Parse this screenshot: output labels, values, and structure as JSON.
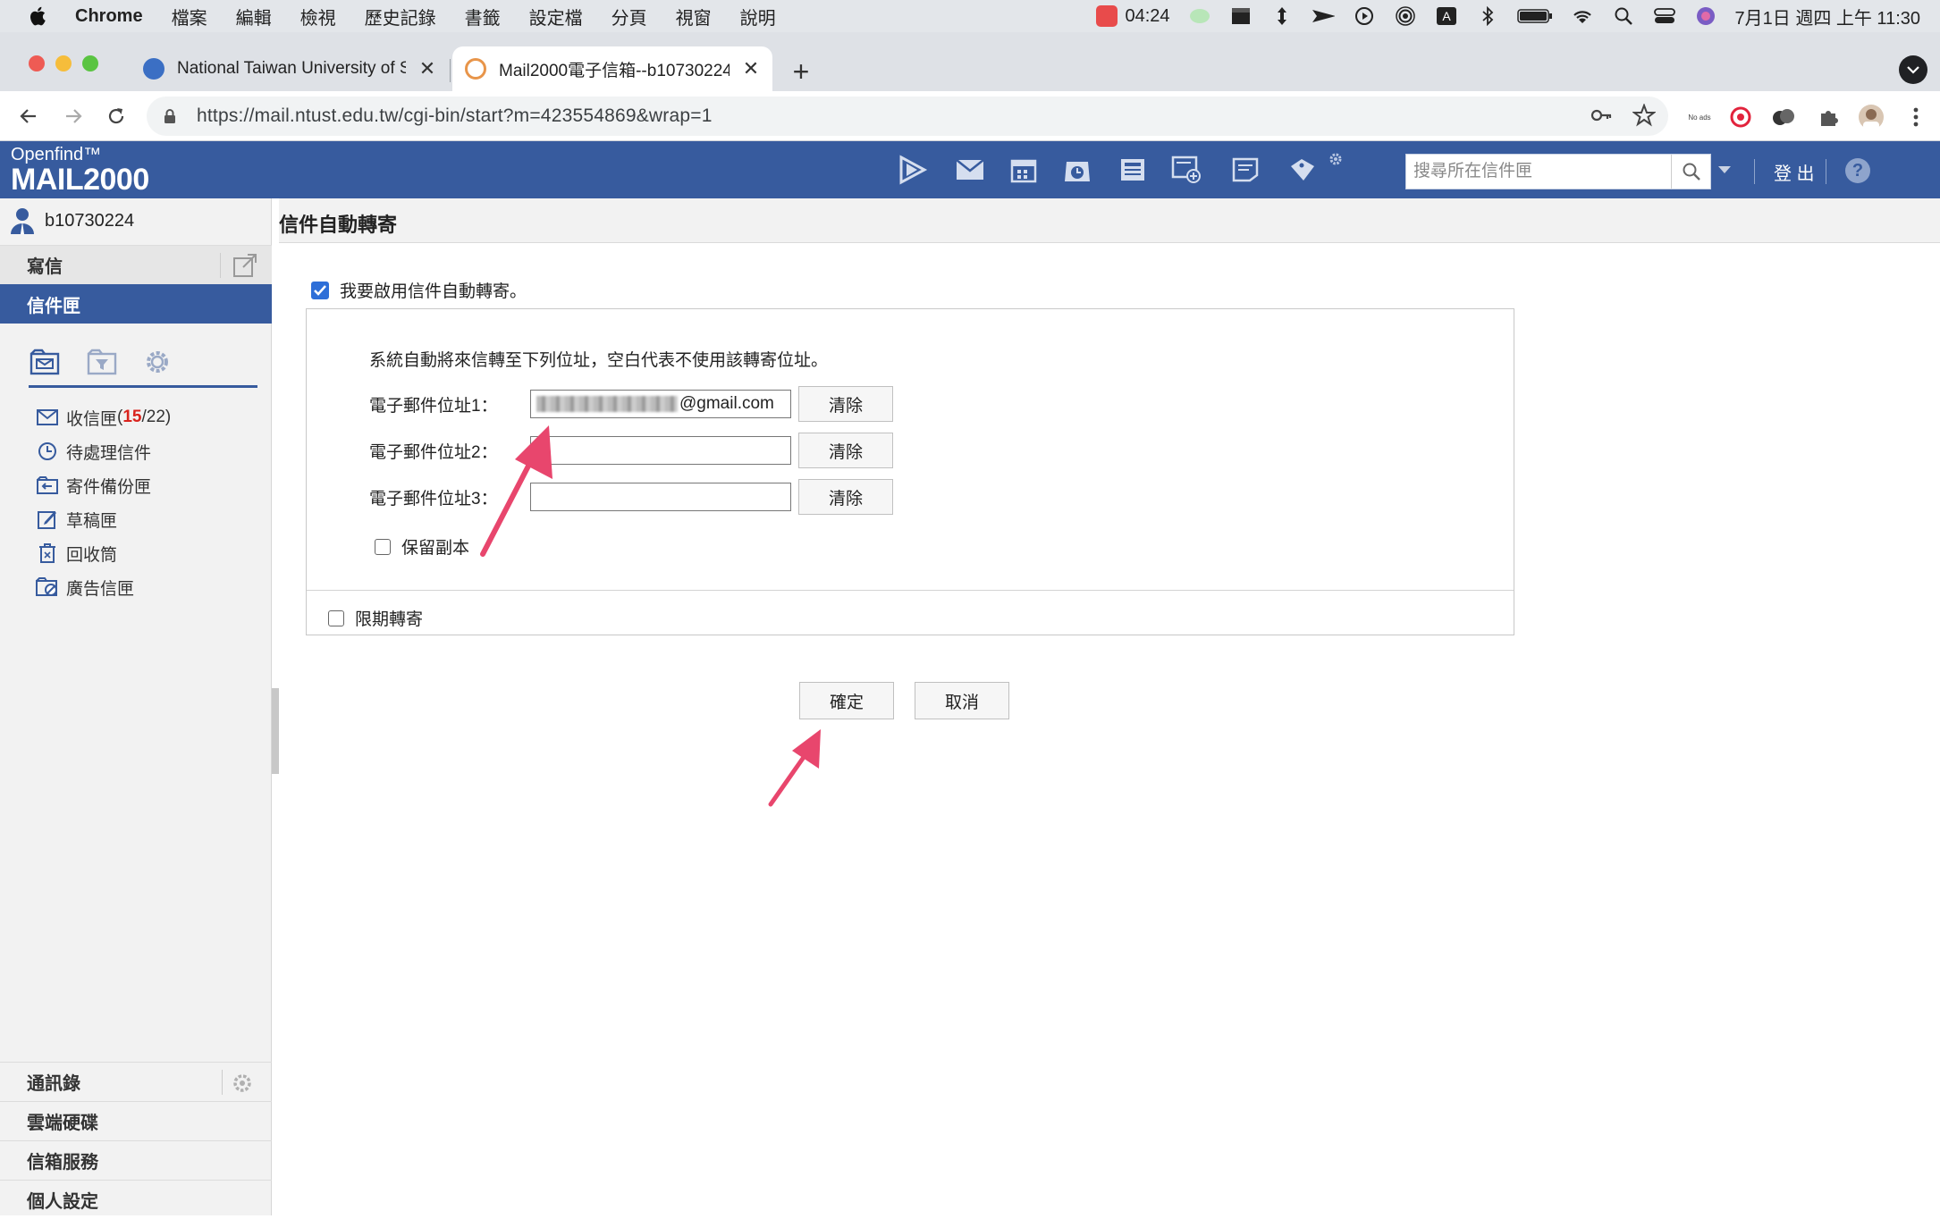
{
  "menubar": {
    "app_name": "Chrome",
    "items": [
      "檔案",
      "編輯",
      "檢視",
      "歷史記錄",
      "書籤",
      "設定檔",
      "分頁",
      "視窗",
      "說明"
    ],
    "timer": "04:24",
    "clock": "7月1日 週四 上午 11:30",
    "input_method": "A"
  },
  "browser": {
    "tabs": [
      {
        "title": "National Taiwan University of S",
        "active": false,
        "favicon_color": "#3b6fc4"
      },
      {
        "title": "Mail2000電子信箱--b10730224",
        "active": true,
        "favicon_color": "#e8954a"
      }
    ],
    "url": "https://mail.ntust.edu.tw/cgi-bin/start?m=423554869&wrap=1",
    "noads_label": "No ads"
  },
  "mail_header": {
    "logo_small": "Openfind™",
    "logo_big": "MAIL2000",
    "search_placeholder": "搜尋所在信件匣",
    "logout_label": "登 出",
    "help_label": "?"
  },
  "sidebar": {
    "username": "b10730224",
    "compose_label": "寫信",
    "mailbox_label": "信件匣",
    "folders": [
      {
        "label": "收信匣",
        "unread": "15",
        "total": "/22)",
        "open": "(",
        "icon": "envelope-icon"
      },
      {
        "label": "待處理信件",
        "icon": "clock-icon"
      },
      {
        "label": "寄件備份匣",
        "icon": "sent-folder-icon"
      },
      {
        "label": "草稿匣",
        "icon": "draft-icon"
      },
      {
        "label": "回收筒",
        "icon": "trash-icon"
      },
      {
        "label": "廣告信匣",
        "icon": "spam-folder-icon"
      }
    ],
    "bottom_nav": [
      "通訊錄",
      "雲端硬碟",
      "信箱服務",
      "個人設定"
    ]
  },
  "page": {
    "title": "信件自動轉寄",
    "enable_label": "我要啟用信件自動轉寄。",
    "enable_checked": true,
    "description": "系統自動將來信轉至下列位址，空白代表不使用該轉寄位址。",
    "addresses": [
      {
        "label": "電子郵件位址1：",
        "value_suffix": "@gmail.com",
        "clear_label": "清除"
      },
      {
        "label": "電子郵件位址2：",
        "value_suffix": "",
        "clear_label": "清除"
      },
      {
        "label": "電子郵件位址3：",
        "value_suffix": "",
        "clear_label": "清除"
      }
    ],
    "keep_copy_label": "保留副本",
    "keep_copy_checked": false,
    "limit_label": "限期轉寄",
    "limit_checked": false,
    "ok_label": "確定",
    "cancel_label": "取消"
  },
  "colors": {
    "brand": "#375b9e",
    "unread": "#d9231d",
    "annotation_arrow": "#e8466d",
    "checkbox": "#2e6fd8"
  }
}
